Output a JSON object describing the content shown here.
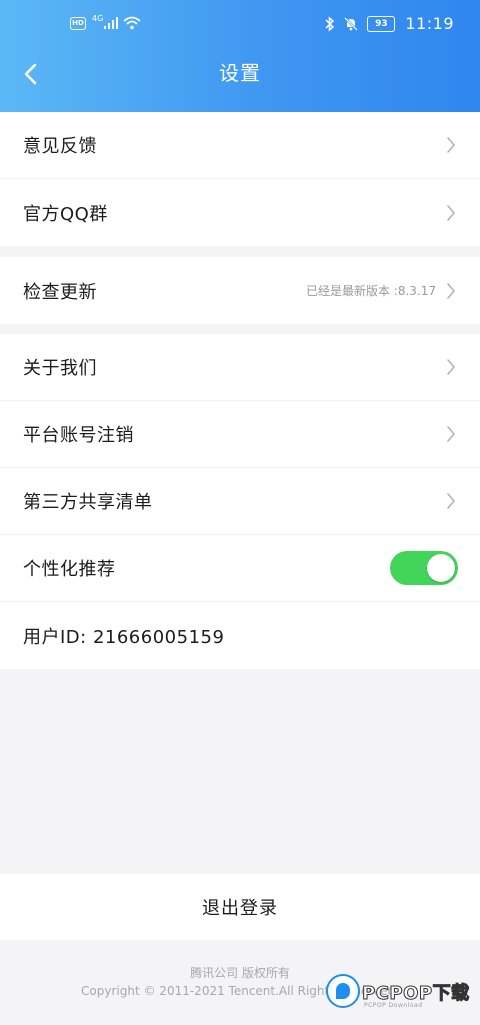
{
  "status_bar": {
    "hd_label": "HD",
    "network_label": "4G",
    "battery_level": "93",
    "time": "11:19"
  },
  "nav": {
    "title": "设置"
  },
  "groups": {
    "g1": [
      {
        "label": "意见反馈"
      },
      {
        "label": "官方QQ群"
      }
    ],
    "g2": [
      {
        "label": "检查更新",
        "value": "已经是最新版本 :8.3.17"
      }
    ],
    "g3": [
      {
        "label": "关于我们"
      },
      {
        "label": "平台账号注销"
      },
      {
        "label": "第三方共享清单"
      },
      {
        "label": "个性化推荐"
      },
      {
        "label": "用户ID: 21666005159"
      }
    ]
  },
  "personalized_toggle": {
    "on": true,
    "color": "#43d45a"
  },
  "logout_label": "退出登录",
  "footer": {
    "line1": "腾讯公司 版权所有",
    "line2": "Copyright © 2011-2021 Tencent.All Rights Reserved."
  },
  "watermark": {
    "brand": "PCPOP下载",
    "sub": "PCPOP Download"
  },
  "colors": {
    "header_start": "#5bb8f6",
    "header_end": "#2f86ee"
  }
}
